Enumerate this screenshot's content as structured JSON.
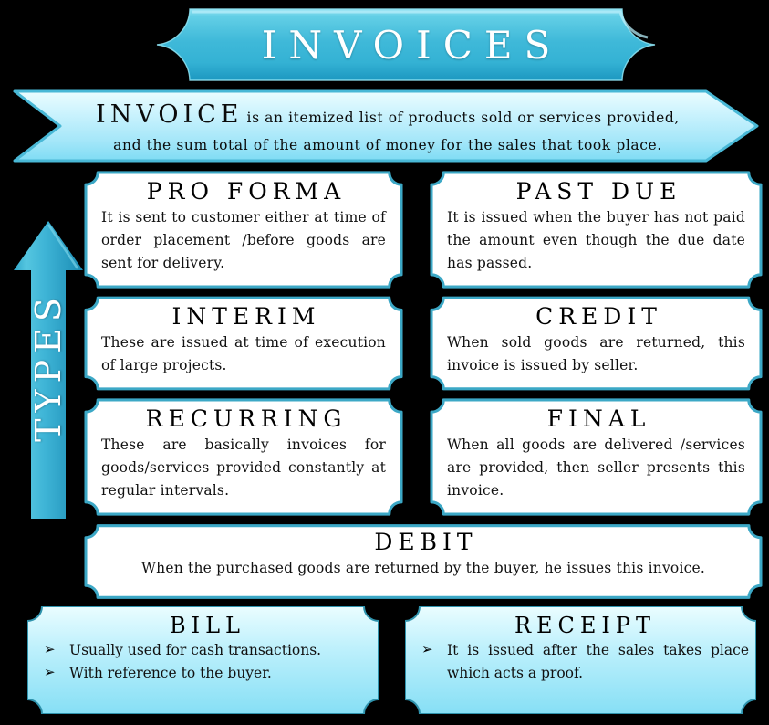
{
  "title": {
    "text": "INVOICES"
  },
  "definition": {
    "lead": "INVOICE",
    "line1": "is an itemized  list  of  products  sold  or  services  provided,",
    "line2": "and  the  sum  total  of  the  amount  of  money  for  the  sales  that  took  place."
  },
  "types_arrow": {
    "label": "TYPES"
  },
  "cards": [
    {
      "title": "PRO FORMA",
      "body": "It is  sent  to  customer  either  at  time  of  order  placement  /before  goods  are  sent  for  delivery."
    },
    {
      "title": "PAST DUE",
      "body": "It is  issued  when  the  buyer  has  not  paid  the  amount  even  though  the  due  date  has  passed."
    },
    {
      "title": "INTERIM",
      "body": "These  are  issued  at  time  of  execution  of  large  projects."
    },
    {
      "title": "CREDIT",
      "body": "When  sold  goods  are  returned,  this  invoice  is  issued  by  seller."
    },
    {
      "title": "RECURRING",
      "body": "These  are  basically  invoices  for  goods/services  provided  constantly  at  regular  intervals."
    },
    {
      "title": "FINAL",
      "body": "When  all  goods  are  delivered  /services  are  provided,  then  seller  presents  this  invoice."
    },
    {
      "title": "DEBIT",
      "body": "When  the  purchased  goods  are  returned  by  the  buyer,  he  issues  this  invoice."
    }
  ],
  "panels": [
    {
      "title": "BILL",
      "bullet_glyph": "➢",
      "items": [
        "Usually  used  for  cash  transactions.",
        "With  reference  to  the  buyer."
      ]
    },
    {
      "title": "RECEIPT",
      "bullet_glyph": "➢",
      "items": [
        "It is issued  after  the  sales  takes  place  which  acts  a proof."
      ]
    }
  ],
  "colors": {
    "background": "#000000",
    "accent_teal": "#3ca8c6",
    "ribbon_top": "#62d2e8",
    "ribbon_bottom": "#1f9fc4",
    "banner_fill_light": "#e8fcff",
    "banner_fill": "#a9e8f8",
    "panel_fill": "#b5eefb",
    "card_fill": "#ffffff",
    "text_dark": "#111111",
    "text_light": "#ffffff"
  }
}
